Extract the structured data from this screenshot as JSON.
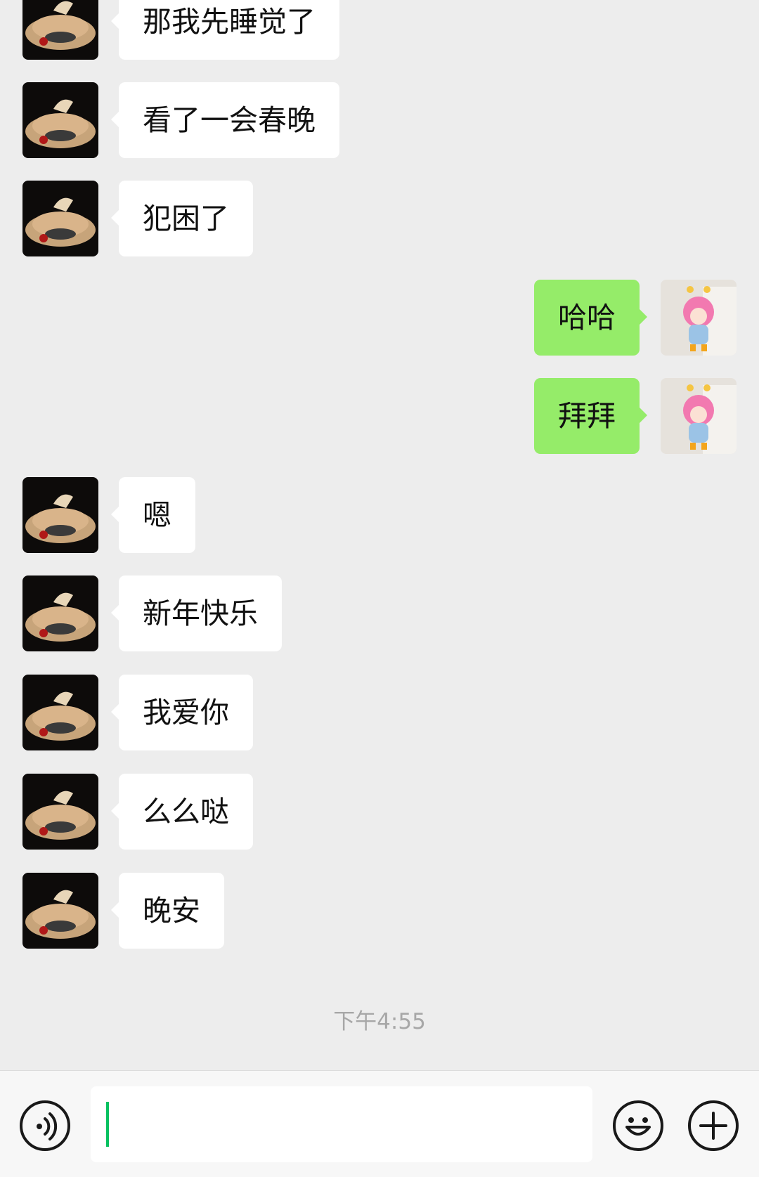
{
  "messages": [
    {
      "side": "in",
      "text": "那我先睡觉了",
      "avatar": "car-avatar"
    },
    {
      "side": "in",
      "text": "看了一会春晚",
      "avatar": "car-avatar"
    },
    {
      "side": "in",
      "text": "犯困了",
      "avatar": "car-avatar"
    },
    {
      "side": "out",
      "text": "哈哈",
      "avatar": "doll-avatar"
    },
    {
      "side": "out",
      "text": "拜拜",
      "avatar": "doll-avatar"
    },
    {
      "side": "in",
      "text": "嗯",
      "avatar": "car-avatar"
    },
    {
      "side": "in",
      "text": "新年快乐",
      "avatar": "car-avatar"
    },
    {
      "side": "in",
      "text": "我爱你",
      "avatar": "car-avatar"
    },
    {
      "side": "in",
      "text": "么么哒",
      "avatar": "car-avatar"
    },
    {
      "side": "in",
      "text": "晚安",
      "avatar": "car-avatar"
    }
  ],
  "timestamp": "下午4:55",
  "input": {
    "value": "",
    "placeholder": ""
  },
  "toolbar": {
    "voice_icon": "voice-icon",
    "emoji_icon": "emoji-icon",
    "plus_icon": "plus-icon"
  },
  "colors": {
    "background": "#ededed",
    "incoming_bubble": "#ffffff",
    "outgoing_bubble": "#95ec69",
    "caret": "#07c160"
  }
}
